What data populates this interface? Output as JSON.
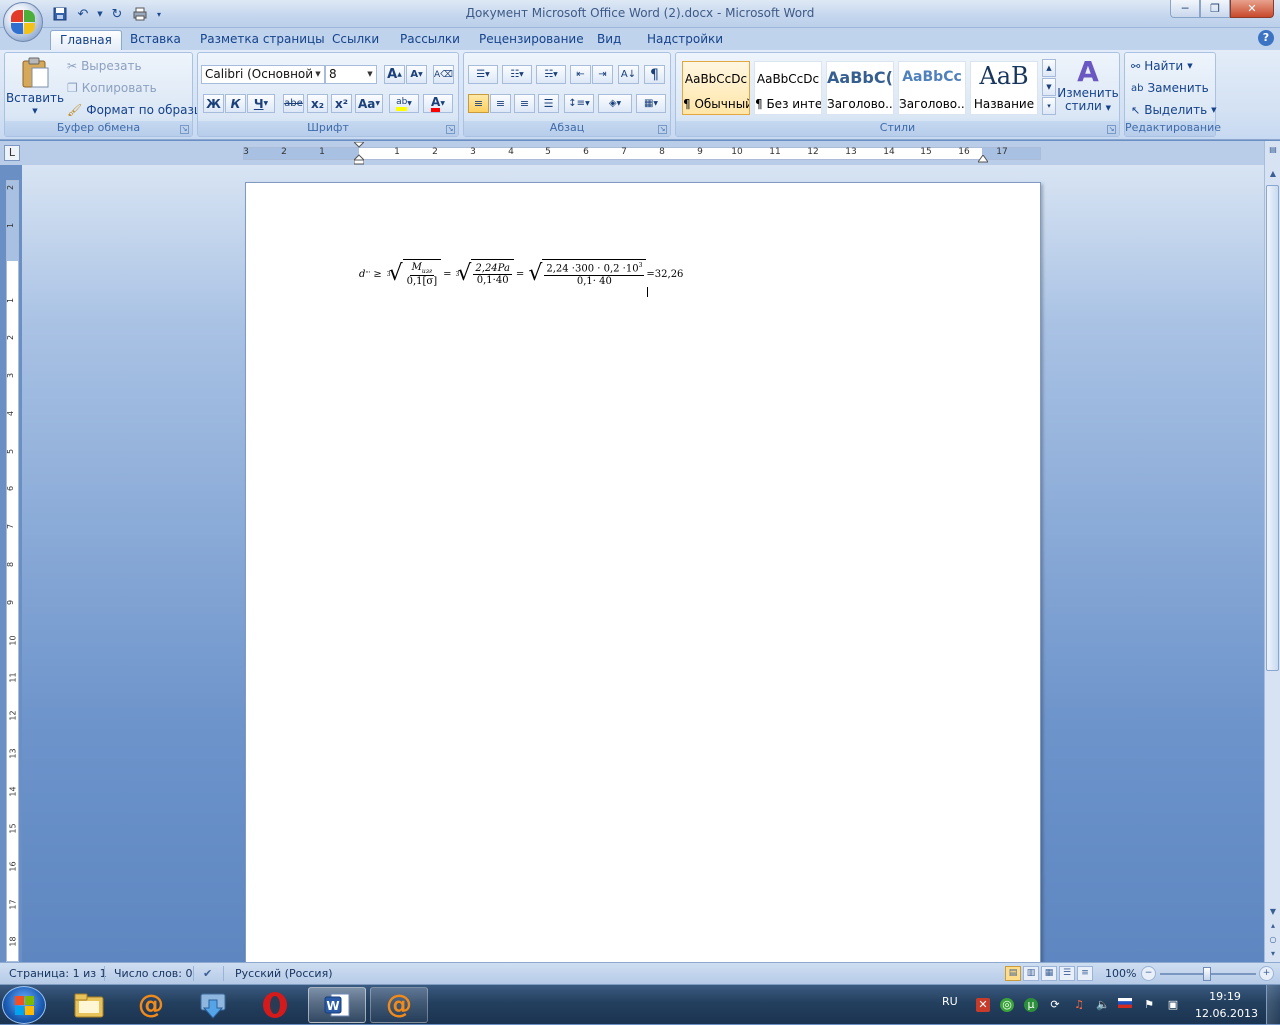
{
  "window": {
    "title": "Документ Microsoft Office Word (2).docx - Microsoft Word",
    "minimize": "─",
    "maximize": "❐",
    "close": "✕"
  },
  "tabs": [
    "Главная",
    "Вставка",
    "Разметка страницы",
    "Ссылки",
    "Рассылки",
    "Рецензирование",
    "Вид",
    "Надстройки"
  ],
  "help_label": "?",
  "clipboard": {
    "paste": "Вставить",
    "cut": "Вырезать",
    "copy": "Копировать",
    "format_painter": "Формат по образцу",
    "label": "Буфер обмена"
  },
  "font": {
    "family": "Calibri (Основной те",
    "size": "8",
    "bold": "Ж",
    "italic": "К",
    "underline": "Ч",
    "strike": "abe",
    "subscript": "x₂",
    "superscript": "x²",
    "case": "Aa",
    "grow": "A",
    "shrink": "A",
    "label": "Шрифт"
  },
  "paragraph": {
    "label": "Абзац",
    "pilcrow": "¶"
  },
  "styles": {
    "label": "Стили",
    "items": [
      {
        "sample": "AaBbCcDc",
        "name": "¶ Обычный"
      },
      {
        "sample": "AaBbCcDc",
        "name": "¶ Без инте..."
      },
      {
        "sample": "AaBbC(",
        "name": "Заголово..."
      },
      {
        "sample": "AaBbCc",
        "name": "Заголово..."
      },
      {
        "sample": "AaB",
        "name": "Название"
      }
    ],
    "change_line1": "Изменить",
    "change_line2": "стили"
  },
  "editing": {
    "label": "Редактирование",
    "find": "Найти",
    "replace": "Заменить",
    "select": "Выделить"
  },
  "ruler": {
    "corner": "L",
    "left_nums": [
      "3",
      "2",
      "1"
    ],
    "right_nums": [
      "1",
      "2",
      "3",
      "4",
      "5",
      "6",
      "7",
      "8",
      "9",
      "10",
      "11",
      "12",
      "13",
      "14",
      "15",
      "16",
      "17"
    ],
    "vert_nums": [
      "2",
      "1",
      "1",
      "2",
      "3",
      "4",
      "5",
      "6",
      "7",
      "8",
      "9",
      "10",
      "11",
      "12",
      "13",
      "14",
      "15",
      "16",
      "17",
      "18"
    ]
  },
  "document": {
    "lhs": "d",
    "lhs_sup": "'''",
    "geq": "≥",
    "root_index": "3",
    "f1_num": "M",
    "f1_num_sub": "изг",
    "f1_den": "0,1[σ]",
    "eq": "=",
    "f2_num": "2,24Pa",
    "f2_den": "0,1·40",
    "f3_num": "2,24 ·300 · 0,2 ·10",
    "f3_num_sup": "3",
    "f3_den": "0,1· 40",
    "result": "=32,26"
  },
  "status": {
    "page": "Страница: 1 из 1",
    "words": "Число слов: 0",
    "language": "Русский (Россия)",
    "zoom": "100%",
    "zoom_minus": "−",
    "zoom_plus": "+"
  },
  "taskbar": {
    "lang": "RU",
    "time": "19:19",
    "date": "12.06.2013"
  },
  "colors": {
    "highlight": "#ffff00",
    "font_color": "#ff0000",
    "office_red": "#e23b2a",
    "office_green": "#4caf3a",
    "office_blue": "#2f6fd0",
    "office_yellow": "#f2c21b"
  }
}
